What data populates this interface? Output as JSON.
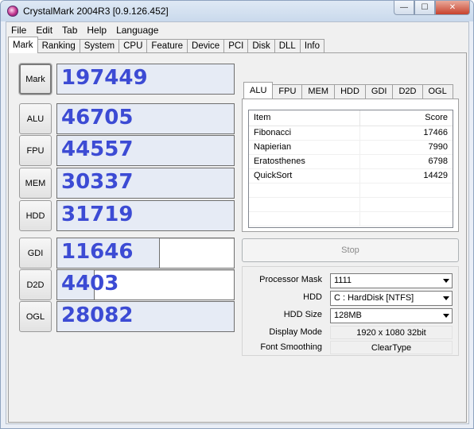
{
  "window": {
    "title": "CrystalMark 2004R3 [0.9.126.452]",
    "minimize_glyph": "—",
    "maximize_glyph": "☐",
    "close_glyph": "✕"
  },
  "menu": [
    "File",
    "Edit",
    "Tab",
    "Help",
    "Language"
  ],
  "main_tabs": [
    "Mark",
    "Ranking",
    "System",
    "CPU",
    "Feature",
    "Device",
    "PCI",
    "Disk",
    "DLL",
    "Info"
  ],
  "scores": [
    {
      "label": "Mark",
      "value": "197449",
      "fill": 1.0
    },
    {
      "label": "ALU",
      "value": "46705",
      "fill": 1.0
    },
    {
      "label": "FPU",
      "value": "44557",
      "fill": 1.0
    },
    {
      "label": "MEM",
      "value": "30337",
      "fill": 1.0
    },
    {
      "label": "HDD",
      "value": "31719",
      "fill": 1.0
    },
    {
      "label": "GDI",
      "value": "11646",
      "fill": 0.58
    },
    {
      "label": "D2D",
      "value": "4403",
      "fill": 0.21
    },
    {
      "label": "OGL",
      "value": "28082",
      "fill": 1.0
    }
  ],
  "sub_tabs": [
    "ALU",
    "FPU",
    "MEM",
    "HDD",
    "GDI",
    "D2D",
    "OGL"
  ],
  "list": {
    "headers": {
      "item": "Item",
      "score": "Score"
    },
    "rows": [
      {
        "item": "Fibonacci",
        "score": "17466"
      },
      {
        "item": "Napierian",
        "score": "7990"
      },
      {
        "item": "Eratosthenes",
        "score": "6798"
      },
      {
        "item": "QuickSort",
        "score": "14429"
      }
    ]
  },
  "stop_label": "Stop",
  "settings": {
    "processor_mask": {
      "label": "Processor Mask",
      "value": "1111"
    },
    "hdd": {
      "label": "HDD",
      "value": "C : HardDisk [NTFS]"
    },
    "hdd_size": {
      "label": "HDD Size",
      "value": "128MB"
    },
    "display_mode": {
      "label": "Display Mode",
      "value": "1920 x 1080 32bit"
    },
    "font_smoothing": {
      "label": "Font Smoothing",
      "value": "ClearType"
    }
  }
}
